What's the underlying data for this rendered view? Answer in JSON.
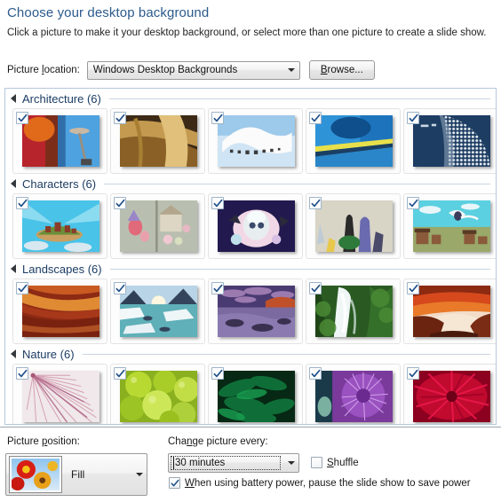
{
  "header": {
    "title": "Choose your desktop background",
    "subtitle": "Click a picture to make it your desktop background, or select more than one picture to create a slide show."
  },
  "location": {
    "label": "Picture location:",
    "selected": "Windows Desktop Backgrounds",
    "browse_label": "Browse...",
    "browse_accel": "B",
    "dropdown_icon": "chevron-down-icon"
  },
  "categories": [
    {
      "name": "Architecture",
      "count": 6,
      "label": "Architecture (6)",
      "expanded": true,
      "collapse_icon": "triangle-expanded-icon",
      "thumbnails": [
        {
          "alt": "space-needle-blue-tower",
          "checked": true
        },
        {
          "alt": "wooden-curved-beams",
          "checked": true
        },
        {
          "alt": "white-ribbon-building-sky",
          "checked": true
        },
        {
          "alt": "blue-metal-curve-yellow-line",
          "checked": true
        },
        {
          "alt": "perforated-metal-dome",
          "checked": true
        }
      ]
    },
    {
      "name": "Characters",
      "count": 6,
      "label": "Characters (6)",
      "expanded": true,
      "collapse_icon": "triangle-expanded-icon",
      "thumbnails": [
        {
          "alt": "flying-island-village-cyan",
          "checked": true
        },
        {
          "alt": "pastel-fairy-houses",
          "checked": true
        },
        {
          "alt": "white-creature-navy-bloom",
          "checked": true
        },
        {
          "alt": "tall-figures-beige-scene",
          "checked": true
        },
        {
          "alt": "flying-girl-desert-town",
          "checked": true
        }
      ]
    },
    {
      "name": "Landscapes",
      "count": 6,
      "label": "Landscapes (6)",
      "expanded": true,
      "collapse_icon": "triangle-expanded-icon",
      "thumbnails": [
        {
          "alt": "red-canyon-reflection",
          "checked": true
        },
        {
          "alt": "icy-lake-mountains-sunrise",
          "checked": true
        },
        {
          "alt": "purple-clouds-rocky-shore",
          "checked": true
        },
        {
          "alt": "waterfall-green-forest",
          "checked": true
        },
        {
          "alt": "red-arch-canyon-sunset",
          "checked": true
        }
      ]
    },
    {
      "name": "Nature",
      "count": 6,
      "label": "Nature (6)",
      "expanded": true,
      "collapse_icon": "triangle-expanded-icon",
      "thumbnails": [
        {
          "alt": "pink-white-spiky-flower",
          "checked": true
        },
        {
          "alt": "green-grapes-closeup",
          "checked": true
        },
        {
          "alt": "green-leaves-dark",
          "checked": true
        },
        {
          "alt": "purple-thistle-bloom",
          "checked": true
        },
        {
          "alt": "red-dahlia-petals",
          "checked": true
        }
      ]
    }
  ],
  "options": {
    "picture_position_label": "Picture position:",
    "picture_position_accel": "p",
    "picture_position_value": "Fill",
    "position_thumb_alt": "red-yellow-flowers-preview",
    "change_every_label": "Change picture every:",
    "change_every_accel": "n",
    "interval_value": "30 minutes",
    "shuffle_label": "Shuffle",
    "shuffle_accel": "S",
    "shuffle_checked": false,
    "battery_label": "When using battery power, pause the slide show to save power",
    "battery_accel": "W",
    "battery_checked": true
  },
  "colors": {
    "title": "#2c5a8c",
    "category_label": "#1b3c63",
    "panel_border": "#b6c8da",
    "rule": "#c8d4e0"
  }
}
